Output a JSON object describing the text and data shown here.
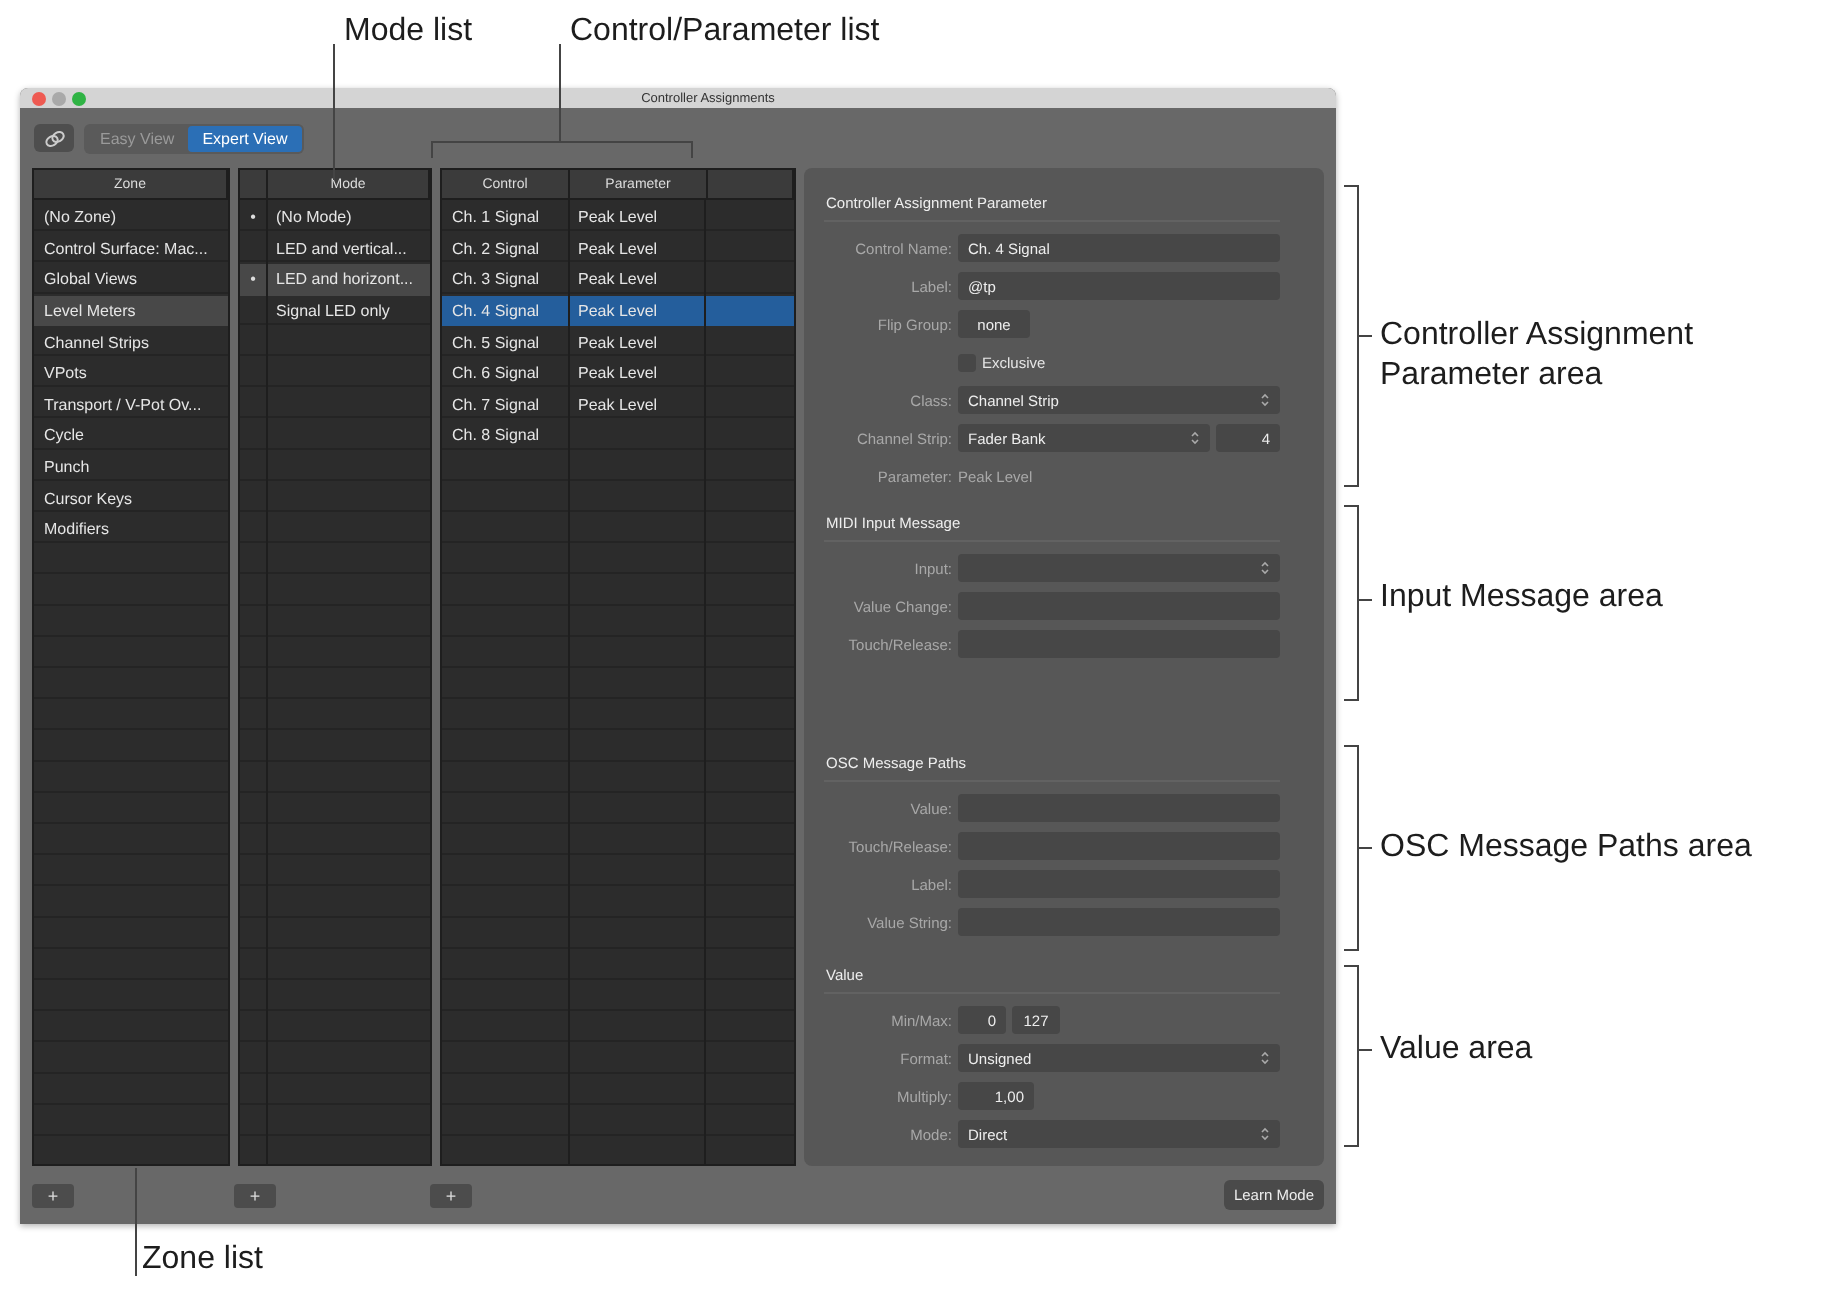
{
  "callouts": [
    {
      "text": "Mode list"
    },
    {
      "text": "Control/Parameter list"
    },
    {
      "text": "Controller Assignment Parameter area"
    },
    {
      "text": "Input Message area"
    },
    {
      "text": "OSC Message Paths area"
    },
    {
      "text": "Value area"
    },
    {
      "text": "Zone list"
    }
  ],
  "window": {
    "title": "Controller Assignments"
  },
  "view_tabs": [
    {
      "label": "Easy View",
      "selected": false
    },
    {
      "label": "Expert View",
      "selected": true
    }
  ],
  "zone_list": {
    "header": "Zone",
    "add": "+",
    "rows": [
      {
        "label": "(No Zone)",
        "selected": false
      },
      {
        "label": "Control Surface: Mac...",
        "selected": false
      },
      {
        "label": "Global Views",
        "selected": false
      },
      {
        "label": "Level Meters",
        "selected": true
      },
      {
        "label": "Channel Strips",
        "selected": false
      },
      {
        "label": "VPots",
        "selected": false
      },
      {
        "label": "Transport / V-Pot Ov...",
        "selected": false
      },
      {
        "label": "Cycle",
        "selected": false
      },
      {
        "label": "Punch",
        "selected": false
      },
      {
        "label": "Cursor Keys",
        "selected": false
      },
      {
        "label": "Modifiers",
        "selected": false
      }
    ]
  },
  "mode_list": {
    "header": "Mode",
    "add": "+",
    "rows": [
      {
        "label": "(No Mode)",
        "bullet": "•",
        "selected": false
      },
      {
        "label": "LED and vertical...",
        "selected": false
      },
      {
        "label": "LED and horizont...",
        "bullet": "•",
        "selected": true
      },
      {
        "label": "Signal LED only",
        "selected": false
      }
    ]
  },
  "control_list": {
    "columns": [
      "Control",
      "Parameter"
    ],
    "add": "+",
    "rows": [
      {
        "control": "Ch. 1 Signal",
        "parameter": "Peak Level",
        "selected": false
      },
      {
        "control": "Ch. 2 Signal",
        "parameter": "Peak Level",
        "selected": false
      },
      {
        "control": "Ch. 3 Signal",
        "parameter": "Peak Level",
        "selected": false
      },
      {
        "control": "Ch. 4 Signal",
        "parameter": "Peak Level",
        "selected": true
      },
      {
        "control": "Ch. 5 Signal",
        "parameter": "Peak Level",
        "selected": false
      },
      {
        "control": "Ch. 6 Signal",
        "parameter": "Peak Level",
        "selected": false
      },
      {
        "control": "Ch. 7 Signal",
        "parameter": "Peak Level",
        "selected": false
      },
      {
        "control": "Ch. 8 Signal",
        "selected": false
      }
    ]
  },
  "sections": [
    {
      "title": "Controller Assignment Parameter",
      "fields": [
        {
          "kind": "text",
          "label": "Control Name:",
          "value": "Ch. 4 Signal"
        },
        {
          "kind": "text",
          "label": "Label:",
          "value": "@tp"
        },
        {
          "kind": "small",
          "label": "Flip Group:",
          "value": "none"
        },
        {
          "kind": "checkbox",
          "label": "Exclusive",
          "checked": false
        },
        {
          "kind": "popup",
          "label": "Class:",
          "value": "Channel Strip"
        },
        {
          "kind": "popup_number",
          "label": "Channel Strip:",
          "value": "Fader Bank",
          "number": "4"
        },
        {
          "kind": "static",
          "label": "Parameter:",
          "value": "Peak Level"
        }
      ]
    },
    {
      "title": "MIDI Input Message",
      "fields": [
        {
          "kind": "popup",
          "label": "Input:"
        },
        {
          "kind": "text",
          "label": "Value Change:"
        },
        {
          "kind": "text",
          "label": "Touch/Release:"
        }
      ]
    },
    {
      "title": "OSC Message Paths",
      "fields": [
        {
          "kind": "text",
          "label": "Value:"
        },
        {
          "kind": "text",
          "label": "Touch/Release:"
        },
        {
          "kind": "text",
          "label": "Label:"
        },
        {
          "kind": "text",
          "label": "Value String:"
        }
      ]
    },
    {
      "title": "Value",
      "fields": [
        {
          "kind": "minmax",
          "label": "Min/Max:",
          "min": "0",
          "max": "127"
        },
        {
          "kind": "popup",
          "label": "Format:",
          "value": "Unsigned"
        },
        {
          "kind": "number",
          "label": "Multiply:",
          "value": "1,00"
        },
        {
          "kind": "popup",
          "label": "Mode:",
          "value": "Direct"
        }
      ]
    }
  ],
  "learn_button": "Learn Mode"
}
